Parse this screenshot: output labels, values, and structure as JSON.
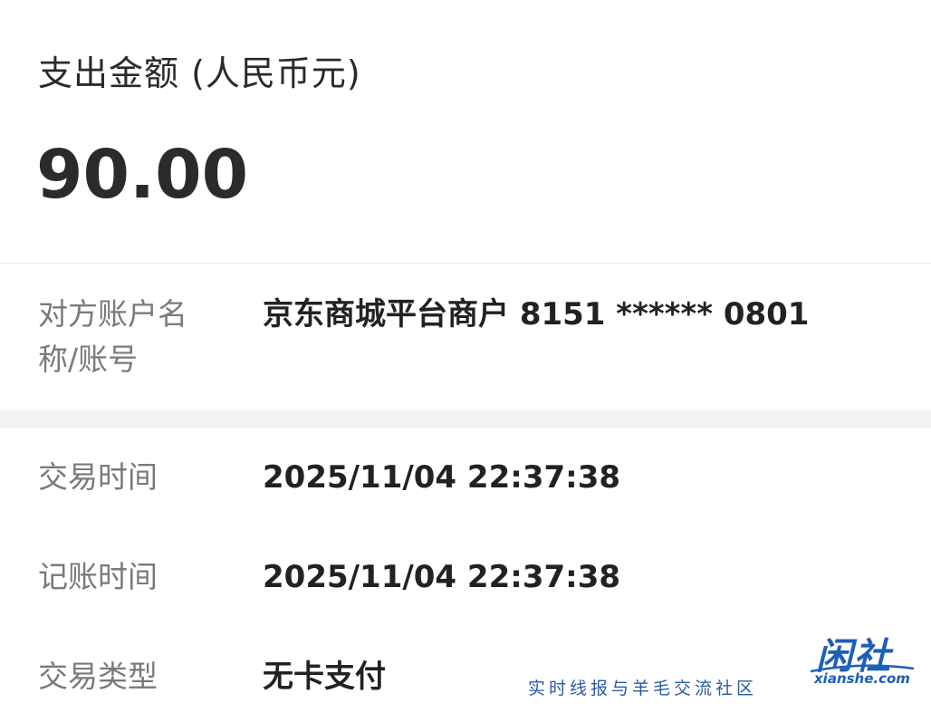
{
  "summary": {
    "amount_label": "支出金额 (人民币元)",
    "amount_value": "90.00"
  },
  "details": {
    "account_label": "对方账户名称/账号",
    "account_value": "京东商城平台商户 8151 ****** 0801",
    "trade_time_label": "交易时间",
    "trade_time_value": "2025/11/04 22:37:38",
    "book_time_label": "记账时间",
    "book_time_value": "2025/11/04 22:37:38",
    "trade_type_label": "交易类型",
    "trade_type_value": "无卡支付"
  },
  "watermark": {
    "tagline": "实时线报与羊毛交流社区",
    "logo_text": "闲社",
    "logo_domain": "xianshe.com"
  },
  "colors": {
    "text_primary": "#222222",
    "text_secondary": "#7a7a7a",
    "section_gap": "#f2f2f2",
    "watermark_blue": "#1e5fb8"
  }
}
